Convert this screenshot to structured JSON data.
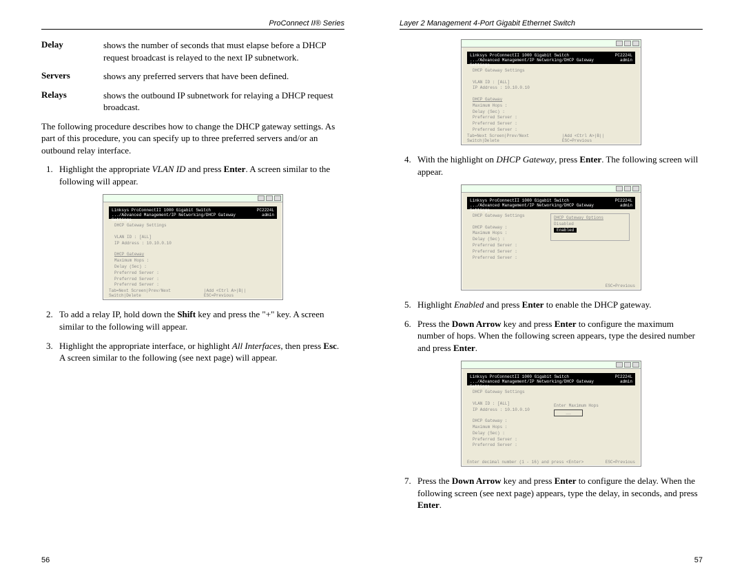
{
  "left": {
    "header": "ProConnect II® Series",
    "definitions": [
      {
        "term": "Delay",
        "desc": "shows the number of seconds that must elapse before a DHCP request broadcast is relayed to the next IP subnetwork."
      },
      {
        "term": "Servers",
        "desc": "shows any preferred servers that have been defined."
      },
      {
        "term": "Relays",
        "desc": "shows the outbound IP subnetwork for relaying a DHCP request broadcast."
      }
    ],
    "para1": "The following procedure describes how to change the DHCP gateway settings. As part of this procedure, you can specify up to three preferred servers and/or an outbound relay interface.",
    "step1a": "Highlight the appropriate ",
    "step1b": "VLAN ID",
    "step1c": " and press ",
    "step1d": "Enter",
    "step1e": ". A screen similar to the following will appear.",
    "step2a": "To add a relay IP, hold down the ",
    "step2b": "Shift",
    "step2c": " key and press the \"+\" key. A screen similar to the following will appear.",
    "step3a": "Highlight the appropriate interface, or highlight ",
    "step3b": "All Interfaces",
    "step3c": ", then press ",
    "step3d": "Esc",
    "step3e": ". A screen similar to the following (see next page) will appear.",
    "pagenum": "56",
    "ss1": {
      "title_l": "Linksys ProConnectII 1000 Gigabit Switch",
      "title_r": "PC2224L",
      "path": ".../Advanced Management/IP Networking/DHCP Gateway Settings",
      "path_r": "admin",
      "body_title": "DHCP Gateway Settings",
      "line1": "VLAN ID : [ALL]",
      "line2": "IP Address : 10.10.0.10",
      "sec_title": "DHCP Gateway",
      "opts": [
        "Maximum Hops :",
        "Delay (Sec) :",
        "Preferred Server :",
        "Preferred Server :",
        "Preferred Server :"
      ],
      "footer_l": "Tab=Next Screen|Prev/Next Switch|Delete",
      "footer_r": "|Add <Ctrl A>|B||  ESC=Previous"
    }
  },
  "right": {
    "header": "Layer 2 Management 4-Port Gigabit Ethernet Switch",
    "step4a": "With the highlight on ",
    "step4b": "DHCP Gateway",
    "step4c": ", press ",
    "step4d": "Enter",
    "step4e": ". The following screen will appear.",
    "step5a": "Highlight ",
    "step5b": "Enabled",
    "step5c": " and press ",
    "step5d": "Enter",
    "step5e": " to enable the DHCP gateway.",
    "step6a": "Press the ",
    "step6b": "Down Arrow",
    "step6c": " key and press ",
    "step6d": "Enter",
    "step6e": " to configure the maximum number of hops. When the following screen appears, type the desired number and press ",
    "step6f": "Enter",
    "step6g": ".",
    "step7a": "Press the ",
    "step7b": "Down Arrow",
    "step7c": " key and press ",
    "step7d": "Enter",
    "step7e": " to configure the delay. When the following screen (see next page) appears, type the delay, in seconds, and press ",
    "step7f": "Enter",
    "step7g": ".",
    "pagenum": "57",
    "ss_top": {
      "title_l": "Linksys ProConnectII 1000 Gigabit Switch",
      "title_r": "PC2224L",
      "path": ".../Advanced Management/IP Networking/DHCP Gateway Settings",
      "path_r": "admin",
      "body_title": "DHCP Gateway Settings",
      "line1": "VLAN ID : [ALL]",
      "line2": "IP Address : 10.10.0.10",
      "sec_title": "DHCP Gateway",
      "opts": [
        "Maximum Hops :",
        "Delay (Sec) :",
        "Preferred Server :",
        "Preferred Server :",
        "Preferred Server :"
      ],
      "footer_l": "Tab=Next Screen|Prev/Next Switch|Delete",
      "footer_r": "|Add <Ctrl A>|B||  ESC=Previous"
    },
    "ss_mid": {
      "title_l": "Linksys ProConnectII 1000 Gigabit Switch",
      "title_r": "PC2224L",
      "path": ".../Advanced Management/IP Networking/DHCP Gateway Settings",
      "path_r": "admin",
      "body_title": "DHCP Gateway Settings",
      "gw_label": "DHCP Gateway :",
      "popup_title": "DHCP Gateway Options",
      "popup_opt1": "Disabled",
      "popup_opt2": "Enabled",
      "opts": [
        "Maximum Hops :",
        "Delay (Sec) :",
        "Preferred Server :",
        "Preferred Server :",
        "Preferred Server :"
      ],
      "footer_l": "",
      "footer_r": "ESC=Previous"
    },
    "ss_bot": {
      "title_l": "Linksys ProConnectII 1000 Gigabit Switch",
      "title_r": "PC2224L",
      "path": ".../Advanced Management/IP Networking/DHCP Gateway Settings",
      "path_r": "admin",
      "body_title": "DHCP Gateway Settings",
      "line1": "VLAN ID : [ALL]",
      "line2": "IP Address : 10.10.0.10",
      "gw_label": "DHCP Gateway :",
      "popup_label": "Enter Maximum Hops",
      "popup_box": "__",
      "opts": [
        "Maximum Hops :",
        "Delay (Sec) :",
        "Preferred Server :",
        "Preferred Server :",
        "Preferred Server :"
      ],
      "footer_l": "Enter decimal number (1 - 16) and press <Enter>",
      "footer_r": "ESC=Previous"
    }
  }
}
